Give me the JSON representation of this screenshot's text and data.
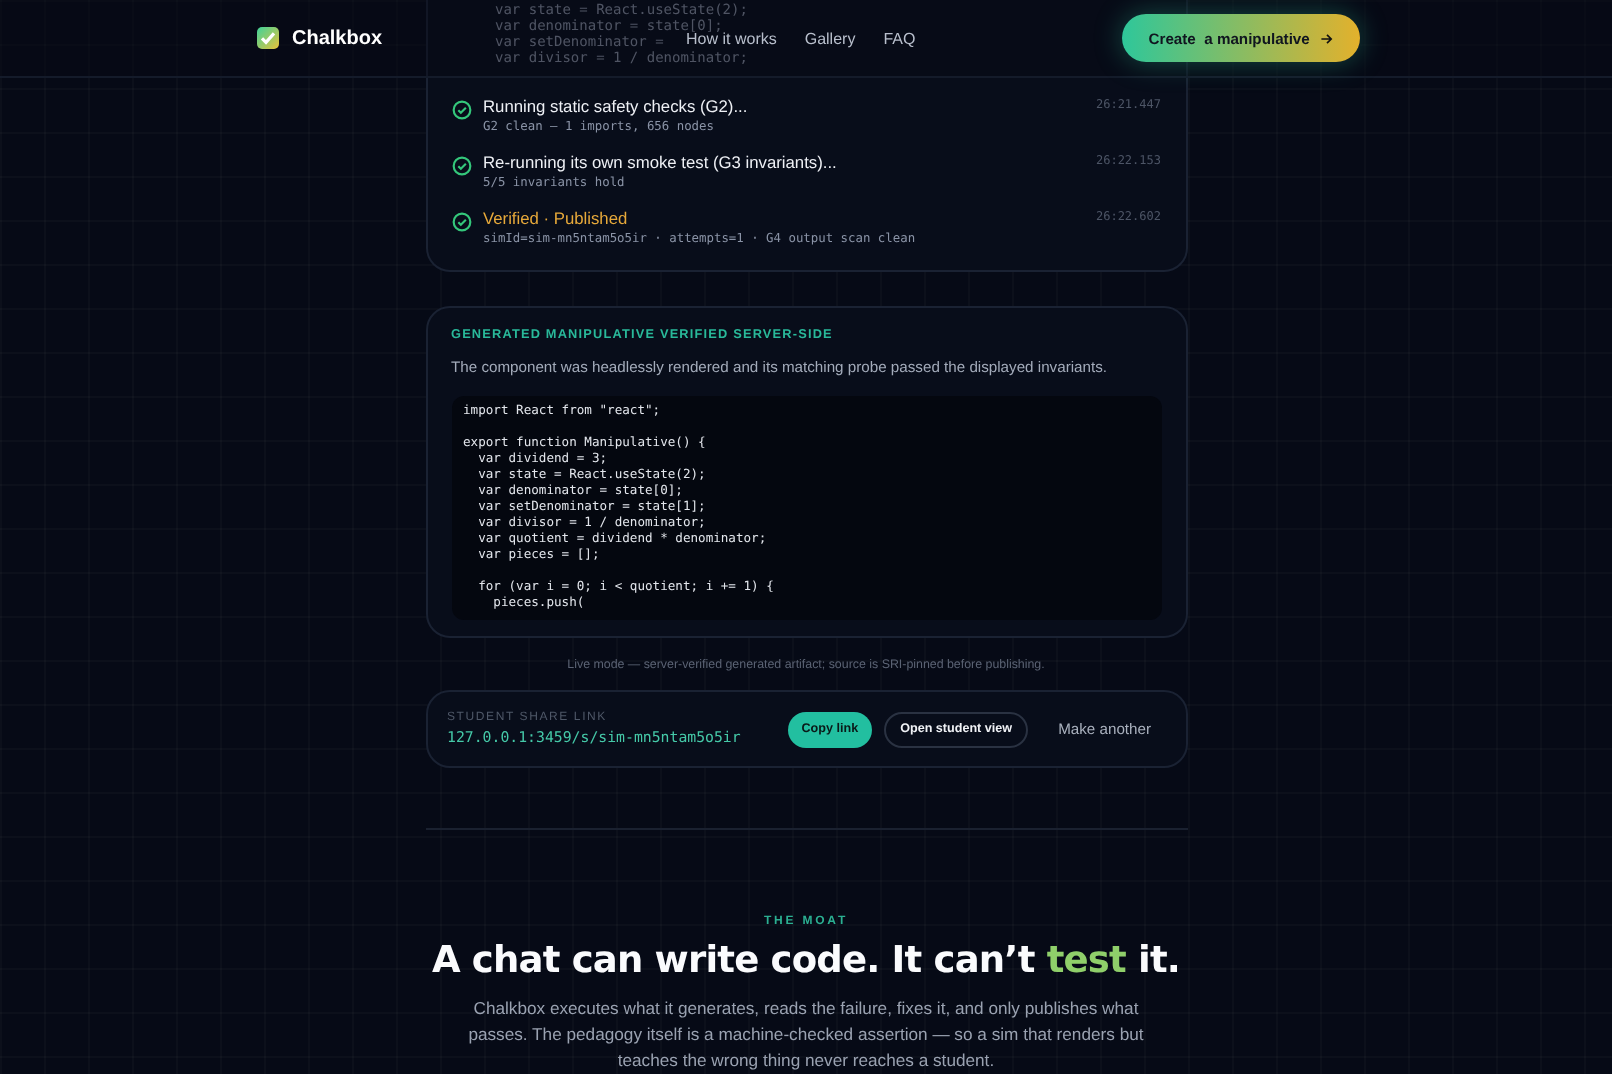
{
  "header": {
    "brand": "Chalkbox",
    "nav": [
      "How it works",
      "Gallery",
      "FAQ"
    ],
    "cta": "Create  a manipulative"
  },
  "progress": {
    "code_lines": [
      "var state = React.useState(2);",
      "var denominator = state[0];",
      "var setDenominator =",
      "var divisor = 1 / denominator;"
    ],
    "steps": [
      {
        "title": "Running static safety checks (G2)...",
        "detail": "G2 clean — 1 imports, 656 nodes",
        "time": "26:21.447",
        "kind": "check"
      },
      {
        "title": "Re-running its own smoke test (G3 invariants)...",
        "detail": "5/5 invariants hold",
        "time": "26:22.153",
        "kind": "check"
      },
      {
        "title": "Verified · Published",
        "detail": "simId=sim-mn5ntam5o5ir · attempts=1 · G4 output scan clean",
        "time": "26:22.602",
        "kind": "final"
      }
    ]
  },
  "artifact": {
    "heading": "GENERATED MANIPULATIVE VERIFIED SERVER-SIDE",
    "description": "The component was headlessly rendered and its matching probe passed the displayed invariants.",
    "code": "import React from \"react\";\n\nexport function Manipulative() {\n  var dividend = 3;\n  var state = React.useState(2);\n  var denominator = state[0];\n  var setDenominator = state[1];\n  var divisor = 1 / denominator;\n  var quotient = dividend * denominator;\n  var pieces = [];\n\n  for (var i = 0; i < quotient; i += 1) {\n    pieces.push("
  },
  "caption": "Live mode — server-verified generated artifact; source is SRI-pinned before publishing.",
  "share": {
    "label": "STUDENT SHARE LINK",
    "url": "127.0.0.1:3459/s/sim-mn5ntam5o5ir",
    "buttons": [
      {
        "label": "Copy link",
        "kind": "primary"
      },
      {
        "label": "Open student view",
        "kind": "outline"
      },
      {
        "label": "Make another",
        "kind": "plain"
      }
    ]
  },
  "moat": {
    "eyebrow": "THE MOAT",
    "heading": "A chat can write code. It can’t **test** it.",
    "body": "Chalkbox executes what it generates, reads the failure, fixes it, and only publishes what passes. The pedagogy itself is a machine-checked assertion — so a sim that renders but teaches the wrong thing never reaches a student."
  }
}
